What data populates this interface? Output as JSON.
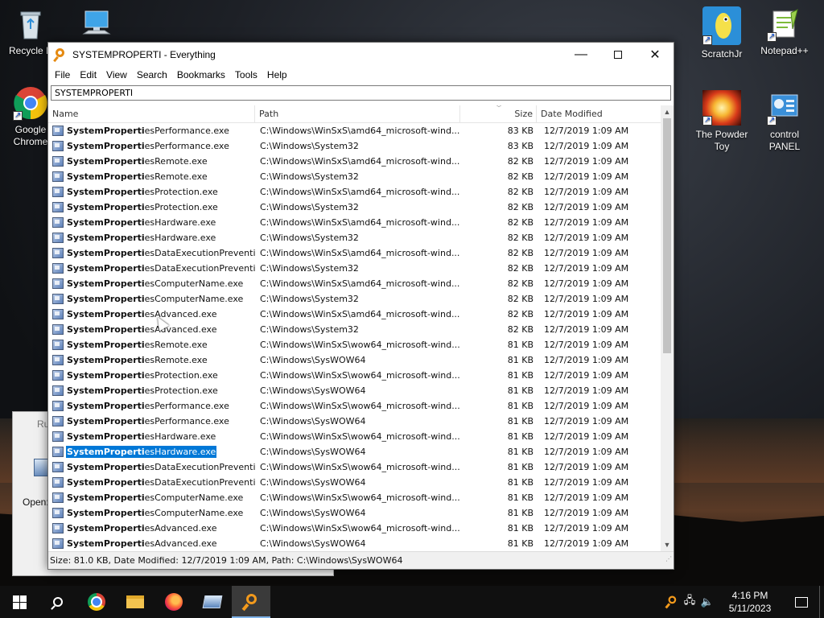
{
  "window": {
    "title": "SYSTEMPROPERTI - Everything",
    "minimize_glyph": "—",
    "close_glyph": "✕",
    "menu": [
      "File",
      "Edit",
      "View",
      "Search",
      "Bookmarks",
      "Tools",
      "Help"
    ],
    "search_value": "SYSTEMPROPERTI"
  },
  "table": {
    "columns": [
      "Name",
      "Path",
      "Size",
      "Date Modified"
    ],
    "rows": [
      {
        "match": "SystemProperti",
        "rest": "esPerformance.exe",
        "path": "C:\\Windows\\WinSxS\\amd64_microsoft-wind...",
        "size": "83 KB",
        "date": "12/7/2019 1:09 AM"
      },
      {
        "match": "SystemProperti",
        "rest": "esPerformance.exe",
        "path": "C:\\Windows\\System32",
        "size": "83 KB",
        "date": "12/7/2019 1:09 AM"
      },
      {
        "match": "SystemProperti",
        "rest": "esRemote.exe",
        "path": "C:\\Windows\\WinSxS\\amd64_microsoft-wind...",
        "size": "82 KB",
        "date": "12/7/2019 1:09 AM"
      },
      {
        "match": "SystemProperti",
        "rest": "esRemote.exe",
        "path": "C:\\Windows\\System32",
        "size": "82 KB",
        "date": "12/7/2019 1:09 AM"
      },
      {
        "match": "SystemProperti",
        "rest": "esProtection.exe",
        "path": "C:\\Windows\\WinSxS\\amd64_microsoft-wind...",
        "size": "82 KB",
        "date": "12/7/2019 1:09 AM"
      },
      {
        "match": "SystemProperti",
        "rest": "esProtection.exe",
        "path": "C:\\Windows\\System32",
        "size": "82 KB",
        "date": "12/7/2019 1:09 AM"
      },
      {
        "match": "SystemProperti",
        "rest": "esHardware.exe",
        "path": "C:\\Windows\\WinSxS\\amd64_microsoft-wind...",
        "size": "82 KB",
        "date": "12/7/2019 1:09 AM"
      },
      {
        "match": "SystemProperti",
        "rest": "esHardware.exe",
        "path": "C:\\Windows\\System32",
        "size": "82 KB",
        "date": "12/7/2019 1:09 AM"
      },
      {
        "match": "SystemProperti",
        "rest": "esDataExecutionPreventi...",
        "path": "C:\\Windows\\WinSxS\\amd64_microsoft-wind...",
        "size": "82 KB",
        "date": "12/7/2019 1:09 AM"
      },
      {
        "match": "SystemProperti",
        "rest": "esDataExecutionPreventi...",
        "path": "C:\\Windows\\System32",
        "size": "82 KB",
        "date": "12/7/2019 1:09 AM"
      },
      {
        "match": "SystemProperti",
        "rest": "esComputerName.exe",
        "path": "C:\\Windows\\WinSxS\\amd64_microsoft-wind...",
        "size": "82 KB",
        "date": "12/7/2019 1:09 AM"
      },
      {
        "match": "SystemProperti",
        "rest": "esComputerName.exe",
        "path": "C:\\Windows\\System32",
        "size": "82 KB",
        "date": "12/7/2019 1:09 AM"
      },
      {
        "match": "SystemProperti",
        "rest": "esAdvanced.exe",
        "path": "C:\\Windows\\WinSxS\\amd64_microsoft-wind...",
        "size": "82 KB",
        "date": "12/7/2019 1:09 AM"
      },
      {
        "match": "SystemProperti",
        "rest": "esAdvanced.exe",
        "path": "C:\\Windows\\System32",
        "size": "82 KB",
        "date": "12/7/2019 1:09 AM"
      },
      {
        "match": "SystemProperti",
        "rest": "esRemote.exe",
        "path": "C:\\Windows\\WinSxS\\wow64_microsoft-wind...",
        "size": "81 KB",
        "date": "12/7/2019 1:09 AM"
      },
      {
        "match": "SystemProperti",
        "rest": "esRemote.exe",
        "path": "C:\\Windows\\SysWOW64",
        "size": "81 KB",
        "date": "12/7/2019 1:09 AM"
      },
      {
        "match": "SystemProperti",
        "rest": "esProtection.exe",
        "path": "C:\\Windows\\WinSxS\\wow64_microsoft-wind...",
        "size": "81 KB",
        "date": "12/7/2019 1:09 AM"
      },
      {
        "match": "SystemProperti",
        "rest": "esProtection.exe",
        "path": "C:\\Windows\\SysWOW64",
        "size": "81 KB",
        "date": "12/7/2019 1:09 AM"
      },
      {
        "match": "SystemProperti",
        "rest": "esPerformance.exe",
        "path": "C:\\Windows\\WinSxS\\wow64_microsoft-wind...",
        "size": "81 KB",
        "date": "12/7/2019 1:09 AM"
      },
      {
        "match": "SystemProperti",
        "rest": "esPerformance.exe",
        "path": "C:\\Windows\\SysWOW64",
        "size": "81 KB",
        "date": "12/7/2019 1:09 AM"
      },
      {
        "match": "SystemProperti",
        "rest": "esHardware.exe",
        "path": "C:\\Windows\\WinSxS\\wow64_microsoft-wind...",
        "size": "81 KB",
        "date": "12/7/2019 1:09 AM"
      },
      {
        "match": "SystemProperti",
        "rest": "esHardware.exe",
        "path": "C:\\Windows\\SysWOW64",
        "size": "81 KB",
        "date": "12/7/2019 1:09 AM",
        "selected": true
      },
      {
        "match": "SystemProperti",
        "rest": "esDataExecutionPreventi...",
        "path": "C:\\Windows\\WinSxS\\wow64_microsoft-wind...",
        "size": "81 KB",
        "date": "12/7/2019 1:09 AM"
      },
      {
        "match": "SystemProperti",
        "rest": "esDataExecutionPreventi...",
        "path": "C:\\Windows\\SysWOW64",
        "size": "81 KB",
        "date": "12/7/2019 1:09 AM"
      },
      {
        "match": "SystemProperti",
        "rest": "esComputerName.exe",
        "path": "C:\\Windows\\WinSxS\\wow64_microsoft-wind...",
        "size": "81 KB",
        "date": "12/7/2019 1:09 AM"
      },
      {
        "match": "SystemProperti",
        "rest": "esComputerName.exe",
        "path": "C:\\Windows\\SysWOW64",
        "size": "81 KB",
        "date": "12/7/2019 1:09 AM"
      },
      {
        "match": "SystemProperti",
        "rest": "esAdvanced.exe",
        "path": "C:\\Windows\\WinSxS\\wow64_microsoft-wind...",
        "size": "81 KB",
        "date": "12/7/2019 1:09 AM"
      },
      {
        "match": "SystemProperti",
        "rest": "esAdvanced.exe",
        "path": "C:\\Windows\\SysWOW64",
        "size": "81 KB",
        "date": "12/7/2019 1:09 AM"
      }
    ]
  },
  "status_bar": "Size: 81.0 KB, Date Modified: 12/7/2019 1:09 AM, Path: C:\\Windows\\SysWOW64",
  "desktop": {
    "icons_left": [
      "Recycle B",
      "Google Chrome"
    ],
    "icons_right": [
      "ScratchJr",
      "Notepad++",
      "The Powder Toy",
      "control PANEL"
    ]
  },
  "run_dialog": {
    "title": "Ru",
    "open_label": "Open:"
  },
  "taskbar": {
    "clock_time": "4:16 PM",
    "clock_date": "5/11/2023"
  },
  "colors": {
    "selection": "#0078d7",
    "accent": "#f39a1c"
  }
}
